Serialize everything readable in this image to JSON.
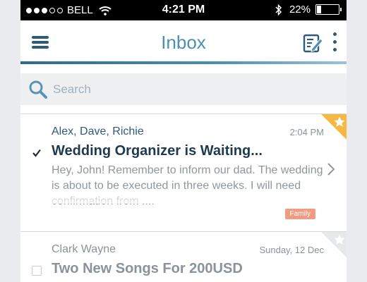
{
  "status_bar": {
    "carrier": "BELL",
    "time": "4:21 PM",
    "battery": "22%",
    "battery_level": 0.22,
    "signal_bars_filled": 3,
    "signal_bars_total": 5
  },
  "nav": {
    "title": "Inbox",
    "menu_icon": "hamburger-menu-icon",
    "compose_icon": "compose-icon",
    "more_icon": "more-vertical-icon"
  },
  "search": {
    "placeholder": "Search",
    "icon": "search-icon"
  },
  "colors": {
    "accent": "#4c8fb4",
    "dark_accent": "#2f5b78",
    "starred": "#f5b942",
    "tag": "#f29b83"
  },
  "messages": [
    {
      "from": "Alex, Dave, Richie",
      "date": "2:04 PM",
      "subject": "Wedding Organizer is Waiting...",
      "preview": "Hey, John! Remember to inform our dad. The wedding is about to be executed in three weeks. I will need confirmation from ....",
      "tag": "Family",
      "checked": true,
      "starred": true,
      "unread": true
    },
    {
      "from": "Clark Wayne",
      "date": "Sunday, 12 Dec",
      "subject": "Two New Songs For 200USD",
      "checked": false,
      "starred": false,
      "unread": false
    }
  ]
}
